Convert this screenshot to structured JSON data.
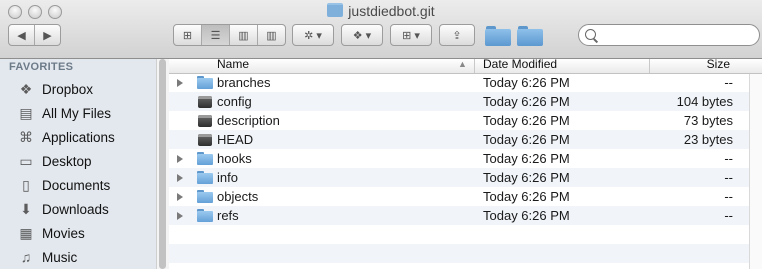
{
  "window": {
    "title": "justdiedbot.git"
  },
  "toolbar": {
    "view_modes": [
      "icon-view-icon",
      "list-view-icon",
      "column-view-icon",
      "coverflow-icon"
    ],
    "active_view": "list-view-icon",
    "action_menu_icon": "gear-icon",
    "dropbox_menu_icon": "dropbox-icon",
    "arrange_menu_icon": "arrange-grid-icon",
    "share_icon": "share-icon",
    "search": {
      "value": "",
      "placeholder": ""
    }
  },
  "sidebar": {
    "heading": "FAVORITES",
    "items": [
      {
        "label": "Dropbox",
        "icon": "dropbox-icon",
        "glyph": "❖"
      },
      {
        "label": "All My Files",
        "icon": "all-files-icon",
        "glyph": "▤"
      },
      {
        "label": "Applications",
        "icon": "applications-icon",
        "glyph": "⌘"
      },
      {
        "label": "Desktop",
        "icon": "desktop-icon",
        "glyph": "▭"
      },
      {
        "label": "Documents",
        "icon": "documents-icon",
        "glyph": "▯"
      },
      {
        "label": "Downloads",
        "icon": "downloads-icon",
        "glyph": "⬇"
      },
      {
        "label": "Movies",
        "icon": "movies-icon",
        "glyph": "▦"
      },
      {
        "label": "Music",
        "icon": "music-icon",
        "glyph": "♫"
      }
    ]
  },
  "columns": {
    "name": "Name",
    "date": "Date Modified",
    "size": "Size"
  },
  "files": [
    {
      "name": "branches",
      "kind": "folder",
      "date": "Today 6:26 PM",
      "size": "--"
    },
    {
      "name": "config",
      "kind": "file",
      "date": "Today 6:26 PM",
      "size": "104 bytes"
    },
    {
      "name": "description",
      "kind": "file",
      "date": "Today 6:26 PM",
      "size": "73 bytes"
    },
    {
      "name": "HEAD",
      "kind": "file",
      "date": "Today 6:26 PM",
      "size": "23 bytes"
    },
    {
      "name": "hooks",
      "kind": "folder",
      "date": "Today 6:26 PM",
      "size": "--"
    },
    {
      "name": "info",
      "kind": "folder",
      "date": "Today 6:26 PM",
      "size": "--"
    },
    {
      "name": "objects",
      "kind": "folder",
      "date": "Today 6:26 PM",
      "size": "--"
    },
    {
      "name": "refs",
      "kind": "folder",
      "date": "Today 6:26 PM",
      "size": "--"
    }
  ]
}
